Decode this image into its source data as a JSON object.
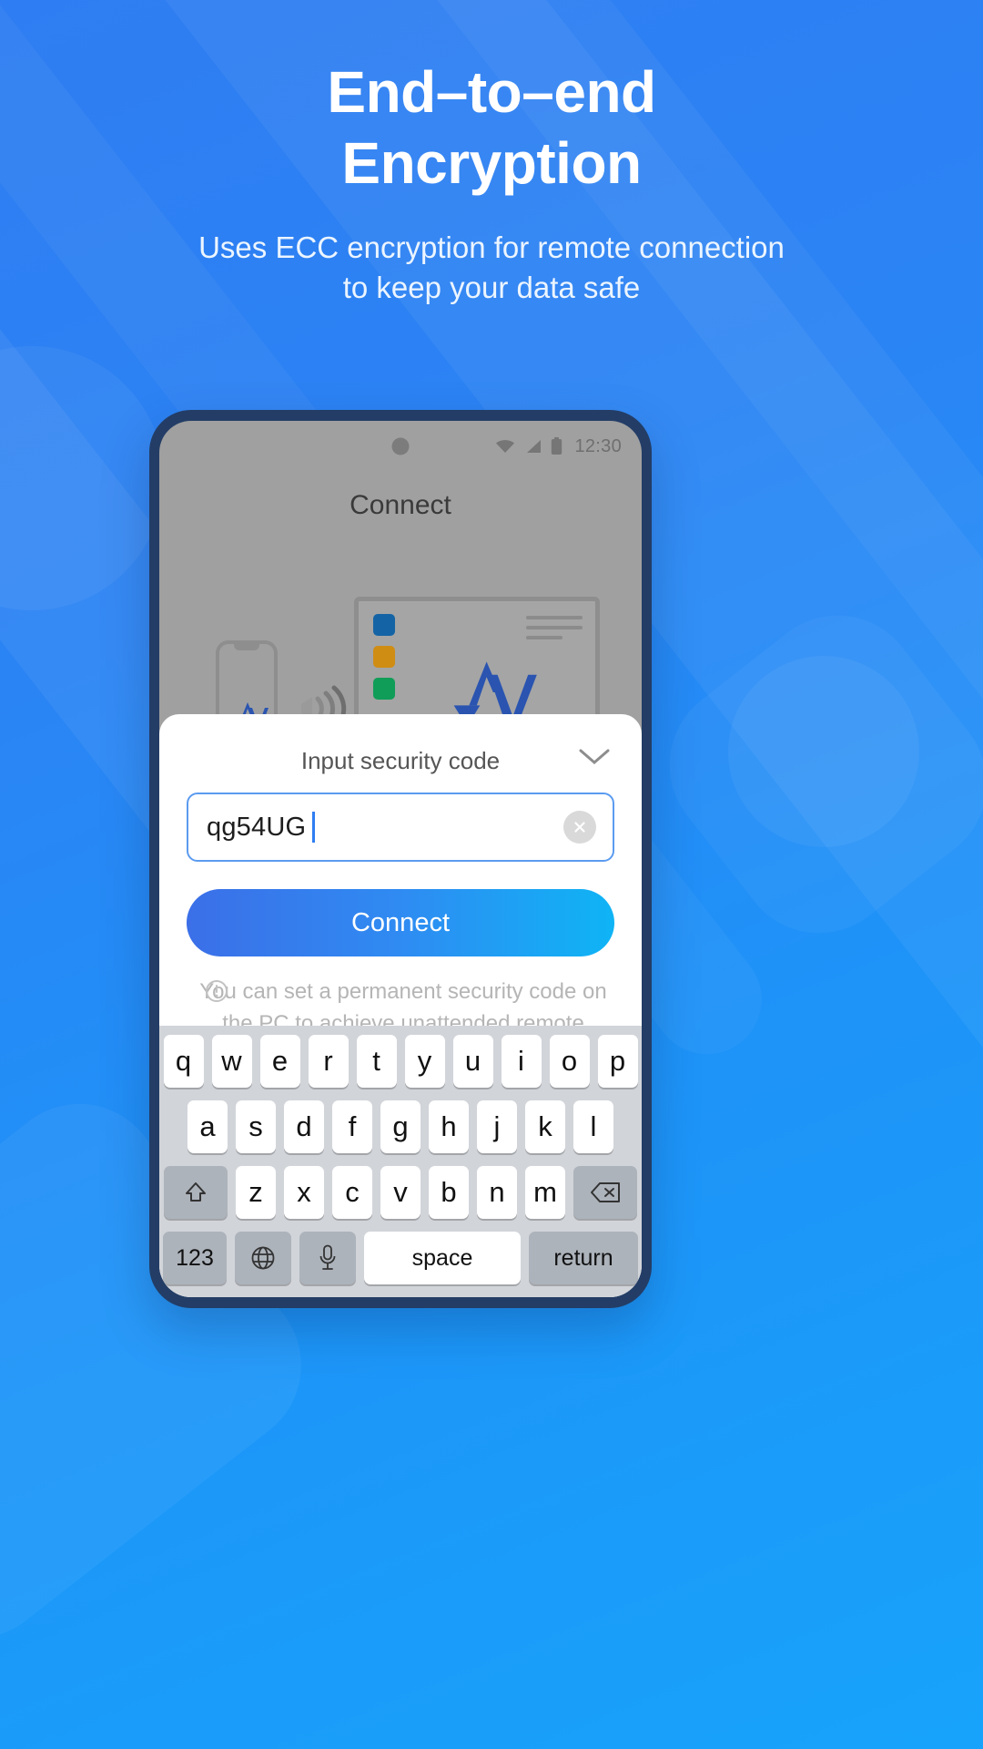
{
  "promo": {
    "title_line1": "End–to–end",
    "title_line2": "Encryption",
    "subtitle_line1": "Uses ECC encryption for remote connection",
    "subtitle_line2": "to keep your data safe"
  },
  "colors": {
    "bg_start": "#2f7df2",
    "bg_end": "#17a3fb",
    "phone_bezel": "#233d66",
    "accent_blue": "#2f7df2",
    "button_gradient_start": "#3b6fe8",
    "button_gradient_end": "#0fb4f5",
    "screen_grey": "#a0a0a0",
    "pc_dot_blue": "#1464a5",
    "pc_dot_orange": "#cf8d14",
    "pc_dot_green": "#0f9d58",
    "logo_blue": "#2a54b0"
  },
  "phone": {
    "statusbar": {
      "time": "12:30",
      "icons": [
        "wifi-icon",
        "signal-icon",
        "battery-icon"
      ]
    },
    "app": {
      "screen_title": "Connect",
      "illustration": {
        "phone_logo": "anyviewer-logo",
        "sound_waves": "sound-waves-icon",
        "pc_logo": "anyviewer-logo",
        "window_dots": [
          "blue",
          "orange",
          "green"
        ]
      }
    },
    "sheet": {
      "title": "Input security code",
      "collapse_icon": "chevron-down-icon",
      "input": {
        "value": "qg54UG",
        "placeholder": "Input security code",
        "clear_icon": "clear-circle-icon"
      },
      "connect_label": "Connect",
      "hint_icon": "info-icon",
      "hint_text": "You can set a permanent security code on the PC to achieve unattended remote access"
    },
    "keyboard": {
      "row1": [
        "q",
        "w",
        "e",
        "r",
        "t",
        "y",
        "u",
        "i",
        "o",
        "p"
      ],
      "row2": [
        "a",
        "s",
        "d",
        "f",
        "g",
        "h",
        "j",
        "k",
        "l"
      ],
      "row3": [
        "z",
        "x",
        "c",
        "v",
        "b",
        "n",
        "m"
      ],
      "shift_icon": "shift-up-icon",
      "backspace_icon": "backspace-icon",
      "numbers_label": "123",
      "globe_icon": "globe-icon",
      "mic_icon": "microphone-icon",
      "space_label": "space",
      "return_label": "return"
    }
  }
}
